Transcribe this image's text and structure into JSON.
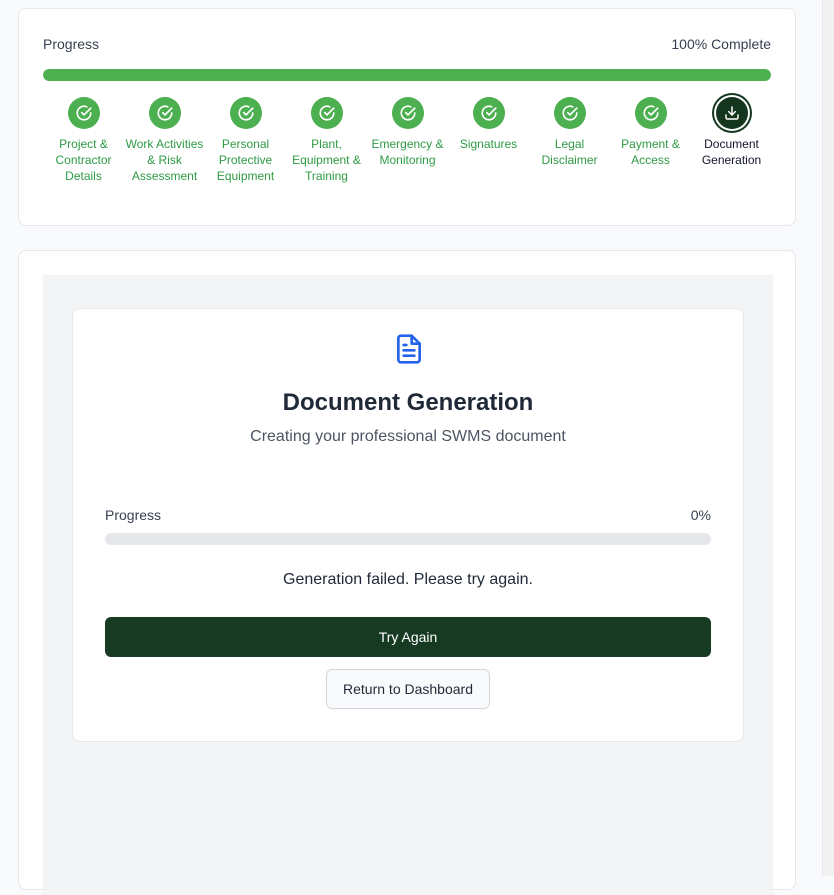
{
  "progress": {
    "label": "Progress",
    "complete_text": "100% Complete",
    "percent": 100,
    "steps": [
      {
        "label": "Project & Contractor Details",
        "status": "complete",
        "icon": "check-circle-icon"
      },
      {
        "label": "Work Activities & Risk Assessment",
        "status": "complete",
        "icon": "check-circle-icon"
      },
      {
        "label": "Personal Protective Equipment",
        "status": "complete",
        "icon": "check-circle-icon"
      },
      {
        "label": "Plant, Equipment & Training",
        "status": "complete",
        "icon": "check-circle-icon"
      },
      {
        "label": "Emergency & Monitoring",
        "status": "complete",
        "icon": "check-circle-icon"
      },
      {
        "label": "Signatures",
        "status": "complete",
        "icon": "check-circle-icon"
      },
      {
        "label": "Legal Disclaimer",
        "status": "complete",
        "icon": "check-circle-icon"
      },
      {
        "label": "Payment & Access",
        "status": "complete",
        "icon": "check-circle-icon"
      },
      {
        "label": "Document Generation",
        "status": "current",
        "icon": "download-icon"
      }
    ]
  },
  "generation": {
    "icon": "file-text-icon",
    "title": "Document Generation",
    "subtitle": "Creating your professional SWMS document",
    "progress_label": "Progress",
    "progress_text": "0%",
    "progress_value": 0,
    "status_message": "Generation failed. Please try again.",
    "try_again_label": "Try Again",
    "dashboard_label": "Return to Dashboard"
  },
  "colors": {
    "complete_green": "#4caf50",
    "dark_green": "#173a22",
    "step_label_green": "#2e9b45",
    "doc_icon_blue": "#2563eb"
  }
}
